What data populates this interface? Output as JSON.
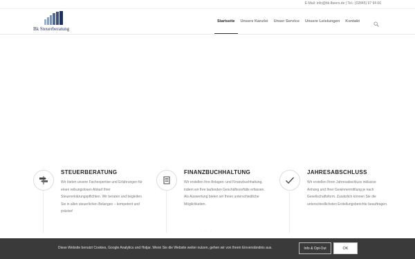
{
  "topbar": {
    "contact": "E-Mail: info@bk-lbeers.de | Tel.: (02845) 97 94 66"
  },
  "header": {
    "logo_text": "Bk Steuerberatung",
    "nav": [
      {
        "label": "Startseite",
        "active": true
      },
      {
        "label": "Unsere Kanzlei"
      },
      {
        "label": "Unser Service"
      },
      {
        "label": "Unsere Leistungen"
      },
      {
        "label": "Kontakt"
      }
    ],
    "search_icon": "search-icon"
  },
  "features": [
    {
      "icon": "signpost-icon",
      "title": "STEUERBERATUNG",
      "text": "Wir bieten unsere Fachexpertise und Erfahrungen für einen reibungslosen Ablauf Ihrer Steuererklärungspflichten. Wir beraten und begleiten Sie in allen steuerlichen Belangen – kompetent und präzise!"
    },
    {
      "icon": "document-icon",
      "title": "FINANZBUCHHALTUNG",
      "text": "Wir erstellen Ihre Anlagen- und Finanzbuchhaltung, indem wir Ihre laufenden Geschäftsvorfälle erfassen. Als Auswertung bieten wir Ihnen unterschiedliche Möglichkeiten."
    },
    {
      "icon": "checkmark-icon",
      "title": "JAHRESABSCHLUSS",
      "text": "Wir erstellen Ihren Jahresabschluss inklusive Anhang und Ihrer Gewinnermittlung je nach Gesellschaftsform. Zusätzlich können Sie die unterschiedlichsten Erstellungsberichte beauftragen."
    }
  ],
  "cookie": {
    "message": "Diese Website benutzt Cookies, Google Analytics und Hotjar. Wenn Sie die Website weiter nutzen, gehen wir von Ihrem Einverständnis aus.",
    "info_button": "Info & Opt-Out",
    "ok_button": "OK"
  },
  "colors": {
    "accent": "#1f2f5c",
    "cookie_bar": "#3a3a3a"
  }
}
